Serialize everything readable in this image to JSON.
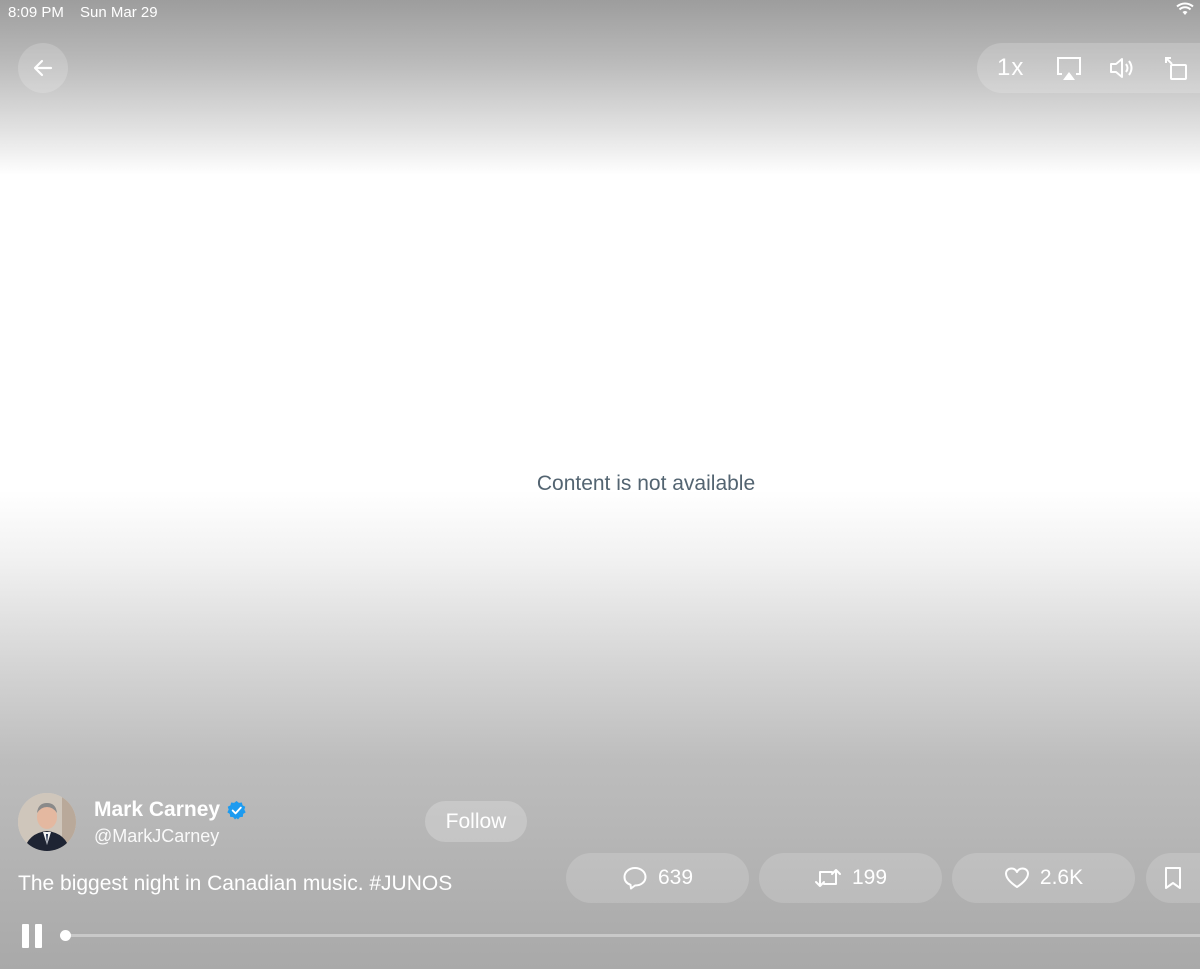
{
  "status_bar": {
    "time": "8:09 PM",
    "date": "Sun Mar 29"
  },
  "player": {
    "speed_label": "1x",
    "unavailable_message": "Content is not available",
    "progress": 0.0
  },
  "post": {
    "author_name": "Mark Carney",
    "author_handle": "@MarkJCarney",
    "verified": true,
    "follow_label": "Follow",
    "text": "The biggest night in Canadian music. #JUNOS",
    "replies": "639",
    "reposts": "199",
    "likes": "2.6K"
  },
  "colors": {
    "verified": "#1d9bf0",
    "message_text": "#536471"
  },
  "icons": [
    "back-arrow-icon",
    "airplay-icon",
    "speaker-icon",
    "rotate-icon",
    "reply-icon",
    "repost-icon",
    "like-icon",
    "bookmark-icon",
    "pause-icon",
    "wifi-icon",
    "verified-badge-icon"
  ]
}
